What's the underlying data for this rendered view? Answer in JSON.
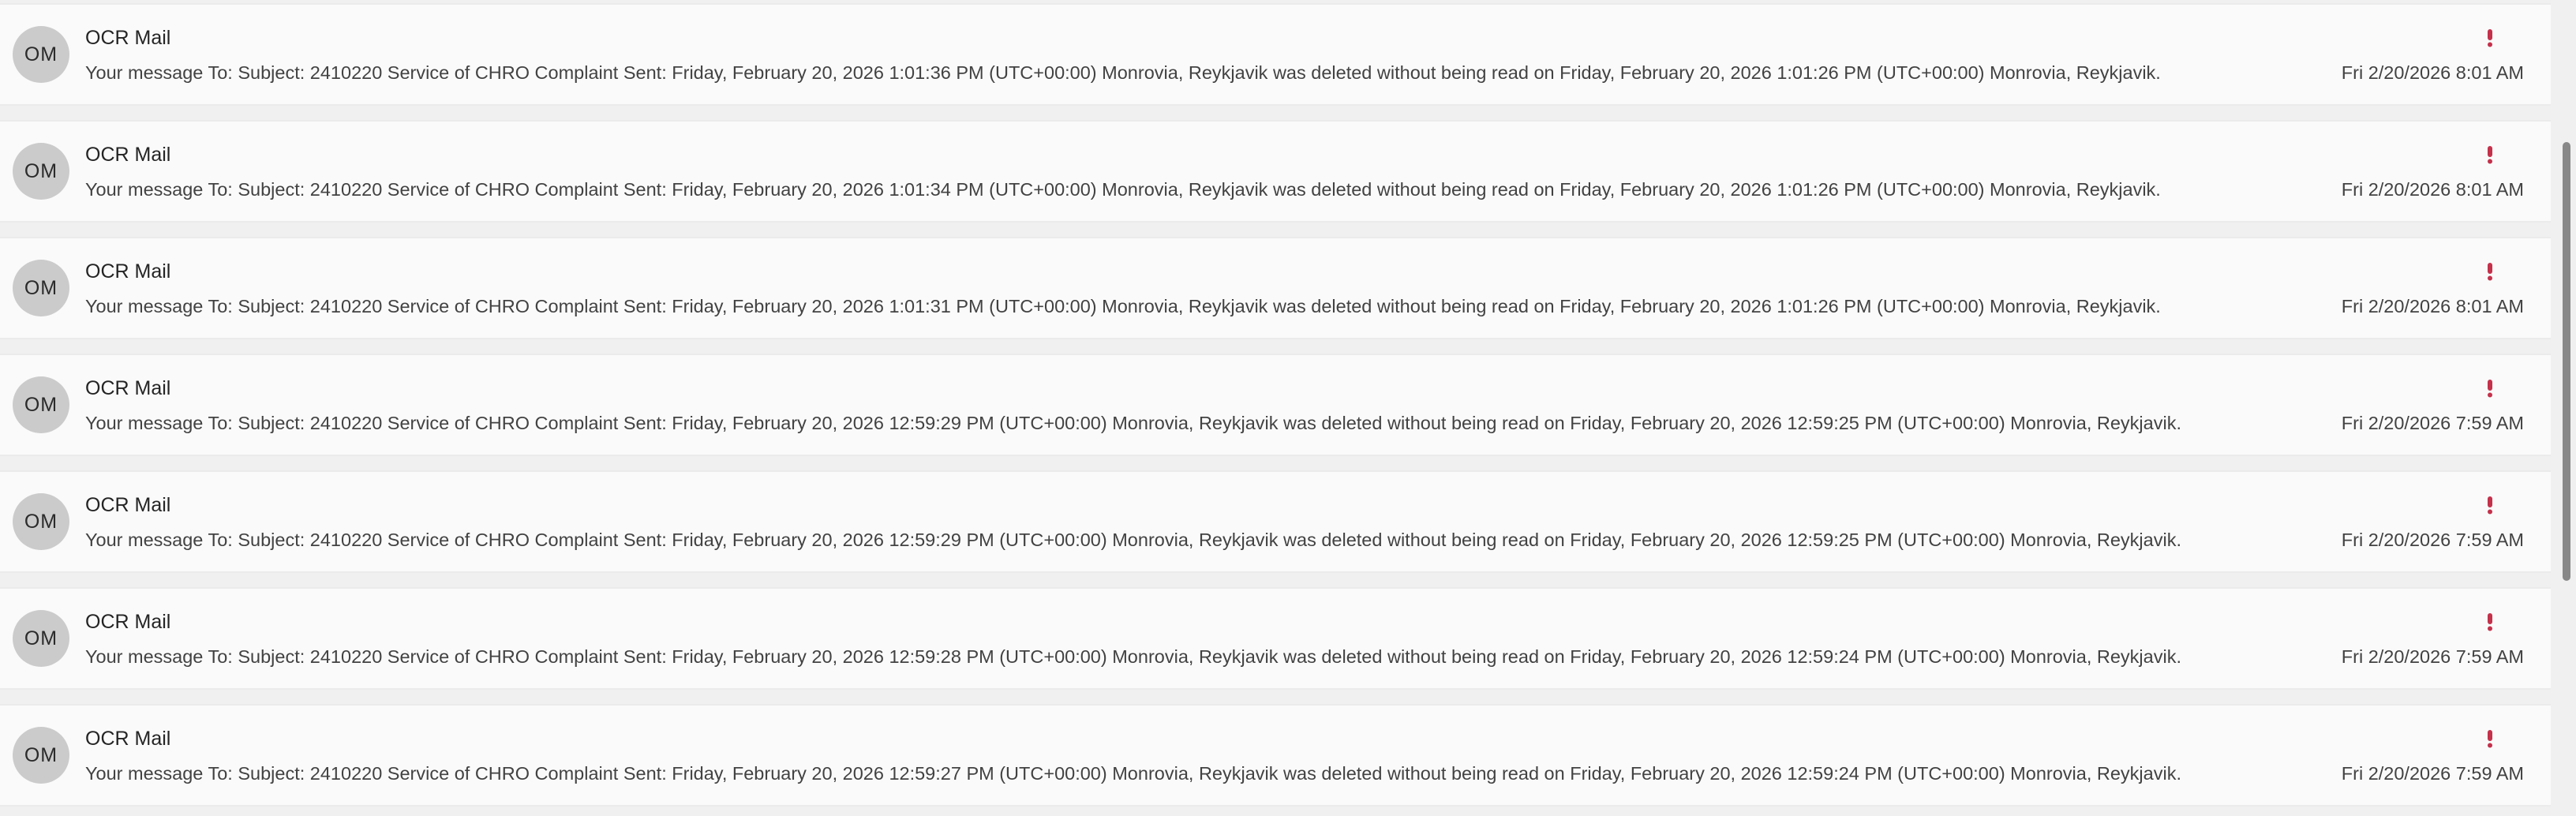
{
  "messages": [
    {
      "initials": "OM",
      "sender": "OCR Mail",
      "preview": "Your message To: Subject: 2410220 Service of CHRO Complaint Sent: Friday, February 20, 2026 1:01:36 PM (UTC+00:00) Monrovia, Reykjavik was deleted without being read on Friday, February 20, 2026 1:01:26 PM (UTC+00:00) Monrovia, Reykjavik.",
      "date": "Fri 2/20/2026 8:01 AM"
    },
    {
      "initials": "OM",
      "sender": "OCR Mail",
      "preview": "Your message To: Subject: 2410220 Service of CHRO Complaint Sent: Friday, February 20, 2026 1:01:34 PM (UTC+00:00) Monrovia, Reykjavik was deleted without being read on Friday, February 20, 2026 1:01:26 PM (UTC+00:00) Monrovia, Reykjavik.",
      "date": "Fri 2/20/2026 8:01 AM"
    },
    {
      "initials": "OM",
      "sender": "OCR Mail",
      "preview": "Your message To: Subject: 2410220 Service of CHRO Complaint Sent: Friday, February 20, 2026 1:01:31 PM (UTC+00:00) Monrovia, Reykjavik was deleted without being read on Friday, February 20, 2026 1:01:26 PM (UTC+00:00) Monrovia, Reykjavik.",
      "date": "Fri 2/20/2026 8:01 AM"
    },
    {
      "initials": "OM",
      "sender": "OCR Mail",
      "preview": "Your message To: Subject: 2410220 Service of CHRO Complaint Sent: Friday, February 20, 2026 12:59:29 PM (UTC+00:00) Monrovia, Reykjavik was deleted without being read on Friday, February 20, 2026 12:59:25 PM (UTC+00:00) Monrovia, Reykjavik.",
      "date": "Fri 2/20/2026 7:59 AM"
    },
    {
      "initials": "OM",
      "sender": "OCR Mail",
      "preview": "Your message To: Subject: 2410220 Service of CHRO Complaint Sent: Friday, February 20, 2026 12:59:29 PM (UTC+00:00) Monrovia, Reykjavik was deleted without being read on Friday, February 20, 2026 12:59:25 PM (UTC+00:00) Monrovia, Reykjavik.",
      "date": "Fri 2/20/2026 7:59 AM"
    },
    {
      "initials": "OM",
      "sender": "OCR Mail",
      "preview": "Your message To: Subject: 2410220 Service of CHRO Complaint Sent: Friday, February 20, 2026 12:59:28 PM (UTC+00:00) Monrovia, Reykjavik was deleted without being read on Friday, February 20, 2026 12:59:24 PM (UTC+00:00) Monrovia, Reykjavik.",
      "date": "Fri 2/20/2026 7:59 AM"
    },
    {
      "initials": "OM",
      "sender": "OCR Mail",
      "preview": "Your message To: Subject: 2410220 Service of CHRO Complaint Sent: Friday, February 20, 2026 12:59:27 PM (UTC+00:00) Monrovia, Reykjavik was deleted without being read on Friday, February 20, 2026 12:59:24 PM (UTC+00:00) Monrovia, Reykjavik.",
      "date": "Fri 2/20/2026 7:59 AM"
    }
  ],
  "icons": {
    "importance": "high-importance-icon"
  },
  "colors": {
    "importance": "#c4314b",
    "avatar_bg": "#cbcbcb",
    "row_bg": "#fafafa",
    "page_bg": "#f0f0f0"
  }
}
